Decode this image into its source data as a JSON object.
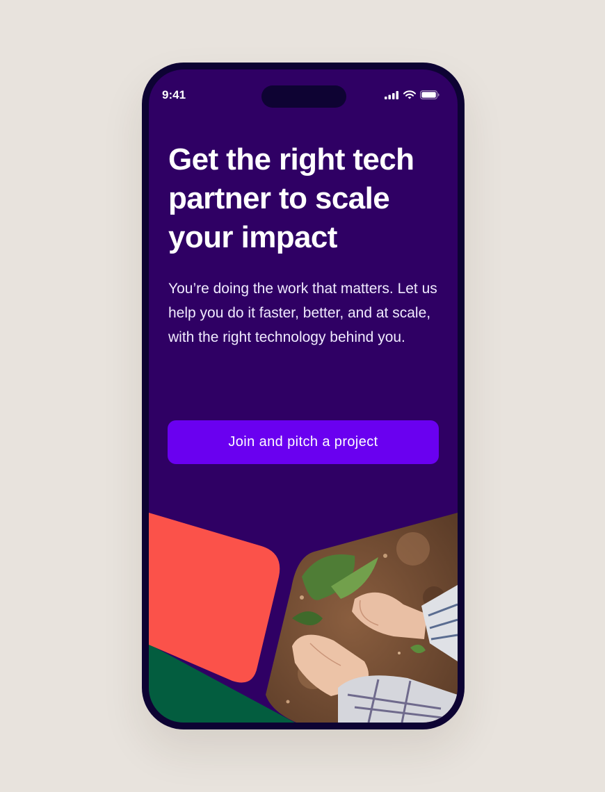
{
  "status_bar": {
    "time": "9:41",
    "icons": [
      "signal-icon",
      "wifi-icon",
      "battery-icon"
    ]
  },
  "hero": {
    "headline": "Get the right tech partner to scale your impact",
    "body": "You’re doing the work that matters. Let us help you do it faster, better, and at scale, with the right technology behind you.",
    "cta_label": "Join and pitch a project"
  },
  "illustration": {
    "shapes": [
      "coral-tile",
      "green-tile",
      "photo-tile"
    ],
    "photo_subject": "hands planting seedlings in soil"
  },
  "colors": {
    "page_background": "#e8e3dd",
    "phone_frame": "#0d0333",
    "screen_background": "#2f0064",
    "cta_background": "#6a00f0",
    "coral": "#fb524a",
    "green": "#035d3f"
  }
}
